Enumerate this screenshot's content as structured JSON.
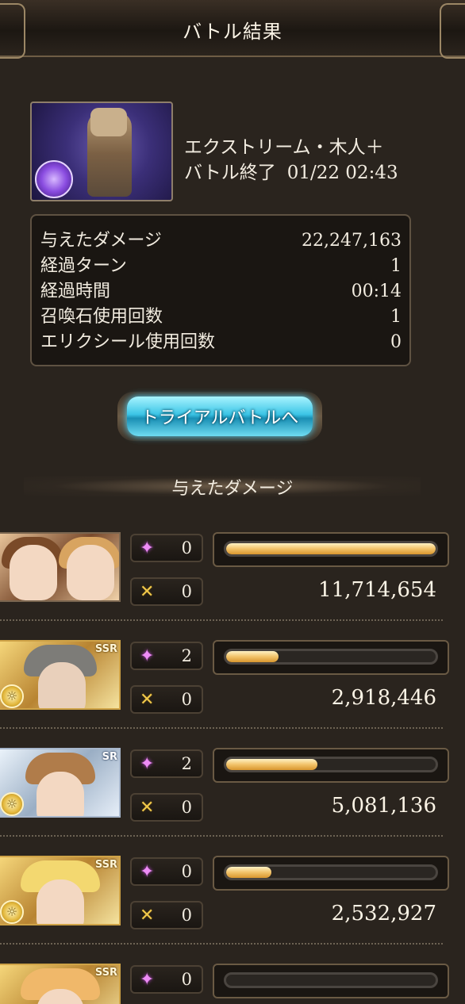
{
  "header": {
    "title": "バトル結果"
  },
  "quest": {
    "name": "エクストリーム・木人＋",
    "end_label": "バトル終了",
    "end_time": "01/22 02:43"
  },
  "stats": [
    {
      "label": "与えたダメージ",
      "value": "22,247,163"
    },
    {
      "label": "経過ターン",
      "value": "1"
    },
    {
      "label": "経過時間",
      "value": "00:14"
    },
    {
      "label": "召喚石使用回数",
      "value": "1"
    },
    {
      "label": "エリクシール使用回数",
      "value": "0"
    }
  ],
  "trial_button": {
    "label": "トライアルバトルへ"
  },
  "damage_section": {
    "title": "与えたダメージ"
  },
  "members": [
    {
      "rarity": "",
      "skills": "0",
      "ougi": "0",
      "damage": "11,714,654",
      "bar_fraction": 1.0
    },
    {
      "rarity": "SSR",
      "skills": "2",
      "ougi": "0",
      "damage": "2,918,446",
      "bar_fraction": 0.249
    },
    {
      "rarity": "SR",
      "skills": "2",
      "ougi": "0",
      "damage": "5,081,136",
      "bar_fraction": 0.434
    },
    {
      "rarity": "SSR",
      "skills": "0",
      "ougi": "0",
      "damage": "2,532,927",
      "bar_fraction": 0.216
    },
    {
      "rarity": "SSR",
      "skills": "0",
      "ougi": "",
      "damage": "",
      "bar_fraction": 0
    }
  ],
  "icons": {
    "skill": "sparkle-icon",
    "ougi": "crossed-swords-icon",
    "element": "light-element-icon"
  },
  "colors": {
    "bar_fill": "#f2c36a",
    "skill_icon": "#ee8cf6",
    "ougi_icon": "#f0c84a",
    "button_glow": "#52d8ff"
  }
}
